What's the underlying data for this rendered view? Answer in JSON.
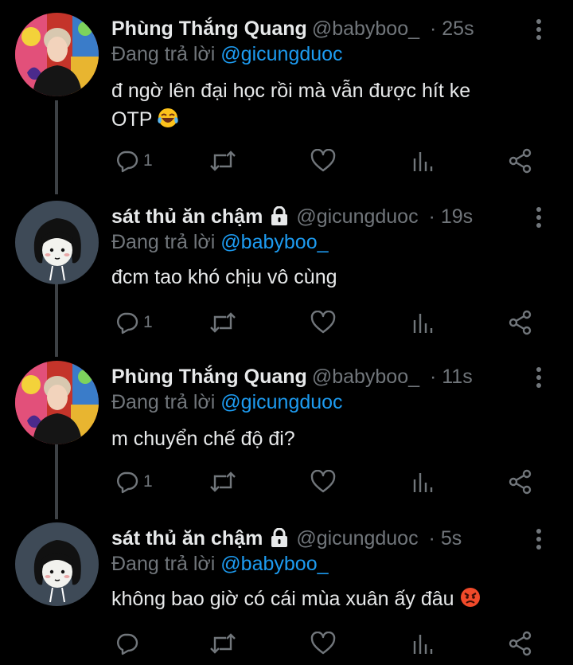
{
  "tweets": [
    {
      "name": "Phùng Thắng Quang",
      "handle": "@babyboo_",
      "time": "· 25s",
      "replying_prefix": "Đang trả lời",
      "replying_to": "@gicungduoc",
      "text_line1": "đ ngờ lên đại học rồi mà vẫn được hít ke",
      "text_line2": "OTP",
      "reply_count": "1",
      "avatar": "photo-avatar",
      "locked": false,
      "emoji": "laughing-tears-emoji"
    },
    {
      "name": "sát thủ ăn chậm",
      "handle": "@gicungduoc",
      "time": "· 19s",
      "replying_prefix": "Đang trả lời",
      "replying_to": "@babyboo_",
      "text_line1": "đcm tao khó chịu vô cùng",
      "reply_count": "1",
      "avatar": "cartoon-avatar",
      "locked": true
    },
    {
      "name": "Phùng Thắng Quang",
      "handle": "@babyboo_",
      "time": "· 11s",
      "replying_prefix": "Đang trả lời",
      "replying_to": "@gicungduoc",
      "text_line1": "m chuyển chế độ đi?",
      "reply_count": "1",
      "avatar": "photo-avatar",
      "locked": false
    },
    {
      "name": "sát thủ ăn chậm",
      "handle": "@gicungduoc",
      "time": "· 5s",
      "replying_prefix": "Đang trả lời",
      "replying_to": "@babyboo_",
      "text_line1": "không bao giờ có cái mùa xuân ấy đâu",
      "reply_count": "",
      "avatar": "cartoon-avatar",
      "locked": true,
      "emoji": "angry-face-emoji"
    }
  ],
  "colors": {
    "background": "#000000",
    "text": "#e7e9ea",
    "secondary": "#71767b",
    "link": "#1d9bf0",
    "thread_line": "#3d4145"
  }
}
